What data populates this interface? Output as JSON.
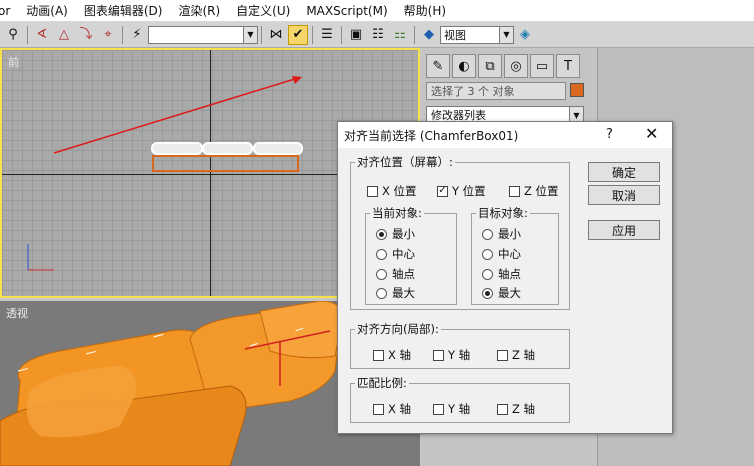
{
  "menubar": {
    "items": [
      "or",
      "动画(A)",
      "图表编辑器(D)",
      "渲染(R)",
      "自定义(U)",
      "MAXScript(M)",
      "帮助(H)"
    ]
  },
  "toolbar": {
    "view_label": "视图",
    "active_tool": "align-icon"
  },
  "viewports": {
    "front_label": "前",
    "persp_label": "透视"
  },
  "command_panel": {
    "selection_text": "选择了 3 个 对象",
    "modifier_list": "修改器列表",
    "color": "#d9691f"
  },
  "dialog": {
    "title": "对齐当前选择 (ChamferBox01)",
    "help": "?",
    "close": "✕",
    "align_position": {
      "title": "对齐位置（屏幕）:",
      "x_label": "X 位置",
      "x_checked": false,
      "y_label": "Y 位置",
      "y_checked": true,
      "z_label": "Z 位置",
      "z_checked": false
    },
    "current_object": {
      "title": "当前对象:",
      "options": [
        "最小",
        "中心",
        "轴点",
        "最大"
      ],
      "selected": 0
    },
    "target_object": {
      "title": "目标对象:",
      "options": [
        "最小",
        "中心",
        "轴点",
        "最大"
      ],
      "selected": 3
    },
    "align_orientation": {
      "title": "对齐方向(局部):",
      "x_label": "X 轴",
      "y_label": "Y 轴",
      "z_label": "Z 轴"
    },
    "match_scale": {
      "title": "匹配比例:",
      "x_label": "X 轴",
      "y_label": "Y 轴",
      "z_label": "Z 轴"
    },
    "buttons": {
      "ok": "确定",
      "cancel": "取消",
      "apply": "应用"
    }
  }
}
